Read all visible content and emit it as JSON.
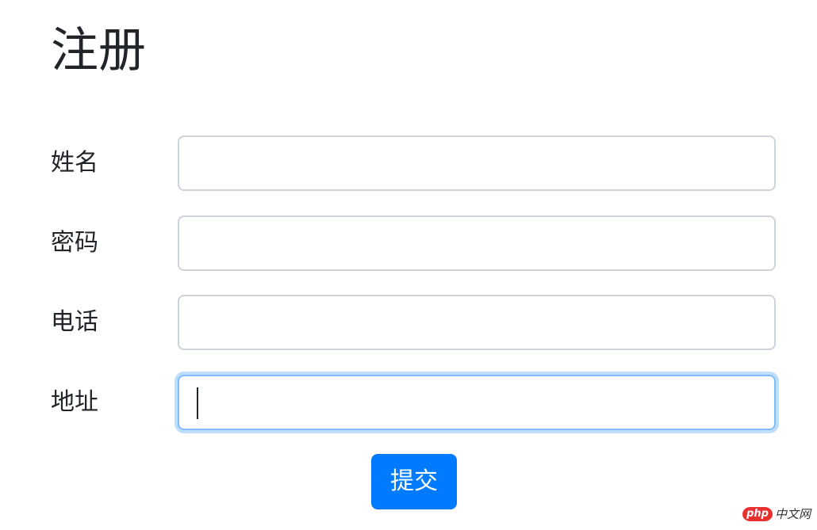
{
  "page": {
    "title": "注册"
  },
  "form": {
    "fields": [
      {
        "label": "姓名",
        "value": "",
        "placeholder": ""
      },
      {
        "label": "密码",
        "value": "",
        "placeholder": ""
      },
      {
        "label": "电话",
        "value": "",
        "placeholder": ""
      },
      {
        "label": "地址",
        "value": "",
        "placeholder": "",
        "focused": true
      }
    ],
    "submit_label": "提交"
  },
  "watermark": {
    "badge": "php",
    "text": "中文网"
  },
  "colors": {
    "primary": "#007bff",
    "input_border": "#ced4da",
    "focus_border": "#80bdff",
    "text": "#212529",
    "watermark_red": "#e8312f"
  }
}
